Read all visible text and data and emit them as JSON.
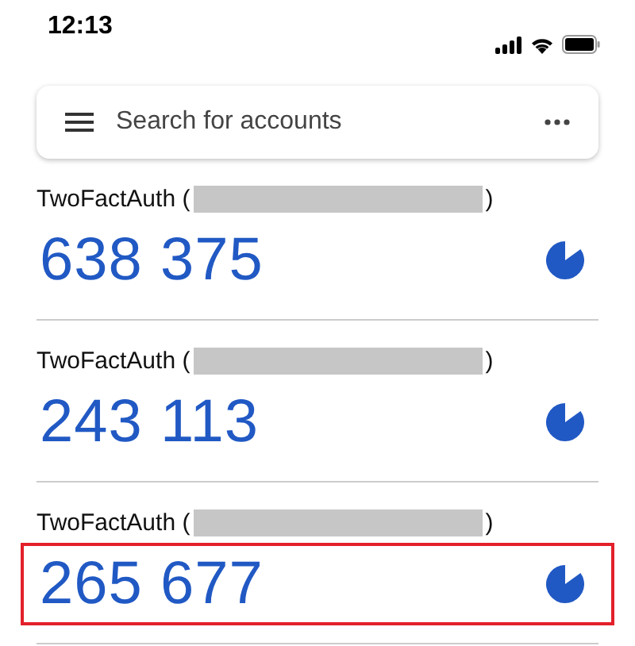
{
  "status_bar": {
    "time": "12:13"
  },
  "search": {
    "placeholder": "Search for accounts"
  },
  "accounts": [
    {
      "issuer": "TwoFactAuth (",
      "issuer_end": ")",
      "code": "638 375",
      "highlighted": false
    },
    {
      "issuer": "TwoFactAuth (",
      "issuer_end": ")",
      "code": "243 113",
      "highlighted": false
    },
    {
      "issuer": "TwoFactAuth (",
      "issuer_end": ")",
      "code": "265 677",
      "highlighted": true
    }
  ]
}
